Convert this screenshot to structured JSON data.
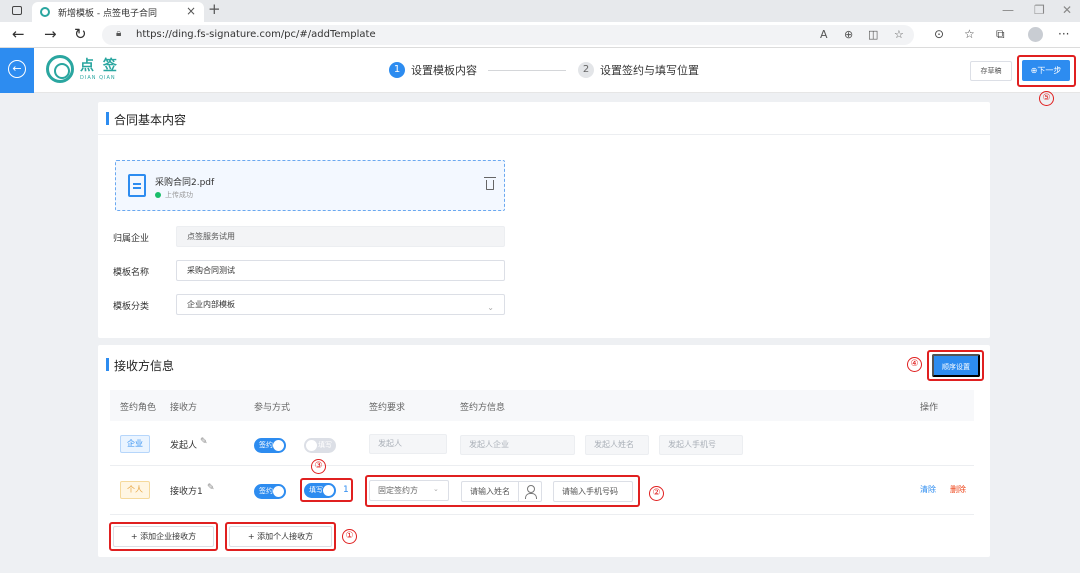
{
  "browser": {
    "tab_title": "新增模板 - 点签电子合同",
    "url": "https://ding.fs-signature.com/pc/#/addTemplate"
  },
  "header": {
    "logo_text": "点 签",
    "logo_sub": "DIAN QIAN",
    "steps": [
      {
        "num": "1",
        "label": "设置模板内容",
        "state": "active"
      },
      {
        "num": "2",
        "label": "设置签约与填写位置",
        "state": "todo"
      }
    ],
    "draft_label": "存草稿",
    "next_label": "⊕下一步"
  },
  "basic": {
    "title": "合同基本内容",
    "file_name": "采购合同2.pdf",
    "file_status": "上传成功",
    "fields": [
      {
        "label": "归属企业",
        "value": "点签服务试用"
      },
      {
        "label": "模板名称",
        "value": "采购合同测试"
      },
      {
        "label": "模板分类",
        "value": "企业内部模板"
      }
    ]
  },
  "recipients": {
    "title": "接收方信息",
    "order_button": "顺序设置",
    "columns": [
      "签约角色",
      "接收方",
      "参与方式",
      "签约要求",
      "签约方信息",
      "操作"
    ],
    "rows": [
      {
        "role": "企业",
        "name": "发起人",
        "sign_switch": "签约",
        "fill_switch": "填写",
        "requirement": "发起人",
        "info": [
          "发起人企业",
          "发起人姓名",
          "发起人手机号"
        ]
      },
      {
        "role": "个人",
        "name": "接收方1",
        "sign_switch": "签约",
        "fill_switch": "填写",
        "fill_count": "1",
        "requirement": "固定签约方",
        "name_placeholder": "请输入姓名",
        "phone_placeholder": "请输入手机号码",
        "op_clear": "清除",
        "op_delete": "删除"
      }
    ],
    "add_enterprise": "+ 添加企业接收方",
    "add_person": "+ 添加个人接收方"
  },
  "annotations": [
    "①",
    "②",
    "③",
    "④",
    "⑤"
  ],
  "colors": {
    "primary": "#2d8cf0",
    "brand": "#2aa6a0",
    "annotation": "#e02020"
  }
}
